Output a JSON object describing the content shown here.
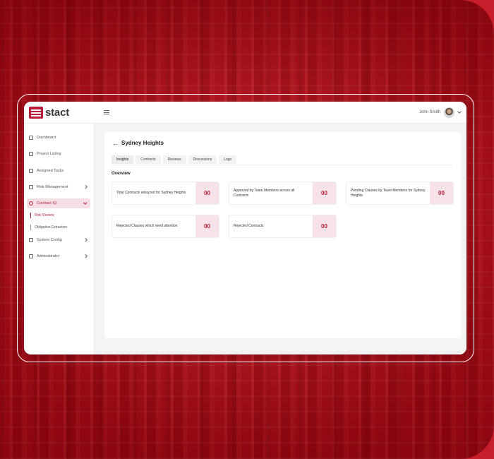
{
  "app": {
    "brand": "stact",
    "user_name": "John Smith"
  },
  "colors": {
    "accent": "#b71c3a",
    "accent_light": "#f6e0e5",
    "background": "#c81e2a"
  },
  "icons": {
    "menu": "hamburger-icon",
    "back": "arrow-left-icon",
    "user_menu": "chevron-down-icon"
  },
  "sidebar": {
    "items": [
      {
        "label": "Dashboard",
        "icon": "grid-icon"
      },
      {
        "label": "Project Listing",
        "icon": "clipboard-icon"
      },
      {
        "label": "Assigned Tasks",
        "icon": "task-icon"
      },
      {
        "label": "Risk Management",
        "icon": "warning-icon"
      },
      {
        "label": "Contract IQ",
        "icon": "globe-icon"
      },
      {
        "label": "System Config",
        "icon": "monitor-icon"
      },
      {
        "label": "Administrator",
        "icon": "admin-icon"
      }
    ],
    "sub_items": [
      {
        "label": "Risk Review"
      },
      {
        "label": "Obligation Extraction"
      }
    ]
  },
  "page": {
    "title": "Sydney Heights",
    "tabs": [
      {
        "label": "Insights"
      },
      {
        "label": "Contracts"
      },
      {
        "label": "Reviews"
      },
      {
        "label": "Discussions"
      },
      {
        "label": "Logs"
      }
    ],
    "section_title": "Overview",
    "stats": [
      {
        "label": "Total Contracts anlayzed for Sydney Heights",
        "value": "00"
      },
      {
        "label": "Approved by Team Members across all Contracts",
        "value": "00"
      },
      {
        "label": "Pending Clauses by Team Members for Sydney Heights",
        "value": "00"
      },
      {
        "label": "Rejected Clauses which need attention",
        "value": "00"
      },
      {
        "label": "Rejected Contracts",
        "value": "00"
      }
    ]
  }
}
